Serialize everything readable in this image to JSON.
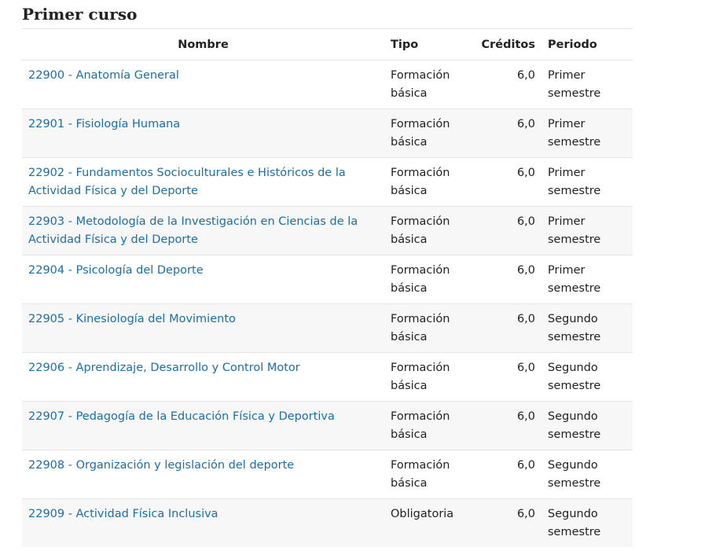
{
  "section": {
    "title": "Primer curso"
  },
  "table": {
    "headers": {
      "name": "Nombre",
      "type": "Tipo",
      "credits": "Créditos",
      "period": "Periodo"
    },
    "rows": [
      {
        "name": "22900 - Anatomía General",
        "type": "Formación básica",
        "credits": "6,0",
        "period": "Primer semestre"
      },
      {
        "name": "22901 - Fisiología Humana",
        "type": "Formación básica",
        "credits": "6,0",
        "period": "Primer semestre"
      },
      {
        "name": "22902 - Fundamentos Socioculturales e Históricos de la Actividad Física y del Deporte",
        "type": "Formación básica",
        "credits": "6,0",
        "period": "Primer semestre"
      },
      {
        "name": "22903 - Metodología de la Investigación en Ciencias de la Actividad Física y del Deporte",
        "type": "Formación básica",
        "credits": "6,0",
        "period": "Primer semestre"
      },
      {
        "name": "22904 - Psicología del Deporte",
        "type": "Formación básica",
        "credits": "6,0",
        "period": "Primer semestre"
      },
      {
        "name": "22905 - Kinesiología del Movimiento",
        "type": "Formación básica",
        "credits": "6,0",
        "period": "Segundo semestre"
      },
      {
        "name": "22906 - Aprendizaje, Desarrollo y Control Motor",
        "type": "Formación básica",
        "credits": "6,0",
        "period": "Segundo semestre"
      },
      {
        "name": "22907 - Pedagogía de la Educación Física y Deportiva",
        "type": "Formación básica",
        "credits": "6,0",
        "period": "Segundo semestre"
      },
      {
        "name": "22908 - Organización y legislación del deporte",
        "type": "Formación básica",
        "credits": "6,0",
        "period": "Segundo semestre"
      },
      {
        "name": "22909 - Actividad Física Inclusiva",
        "type": "Obligatoria",
        "credits": "6,0",
        "period": "Segundo semestre"
      }
    ]
  },
  "colors": {
    "link": "#1a6ea8",
    "stripe": "#f7f7f7",
    "border": "#e5e5e5"
  }
}
